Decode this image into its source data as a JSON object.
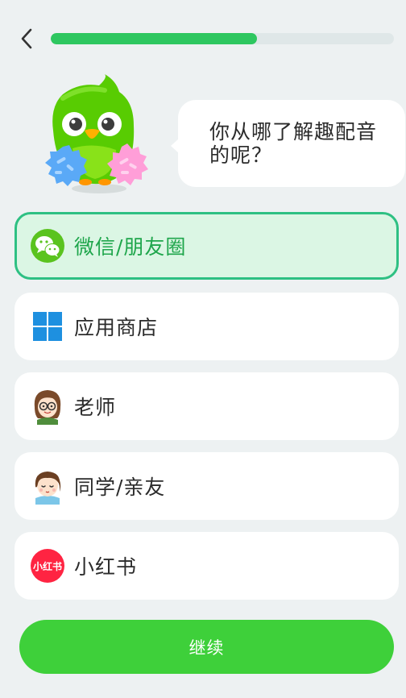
{
  "header": {
    "back_icon": "chevron-left-icon",
    "progress": 0.6
  },
  "prompt": {
    "text": "你从哪了解趣配音的呢？"
  },
  "options": [
    {
      "label": "微信/朋友圈",
      "icon": "wechat-icon",
      "selected": true
    },
    {
      "label": "应用商店",
      "icon": "windows-store-icon",
      "selected": false
    },
    {
      "label": "老师",
      "icon": "teacher-avatar-icon",
      "selected": false
    },
    {
      "label": "同学/亲友",
      "icon": "classmate-avatar-icon",
      "selected": false
    },
    {
      "label": "小红书",
      "icon": "xiaohongshu-icon",
      "selected": false
    }
  ],
  "xhs_logo_text": "小红书",
  "footer": {
    "continue_label": "继续"
  },
  "colors": {
    "accent": "#2ec760",
    "button": "#3ed03a",
    "selected_border": "#2ec083",
    "selected_bg": "#dbf6e4"
  }
}
